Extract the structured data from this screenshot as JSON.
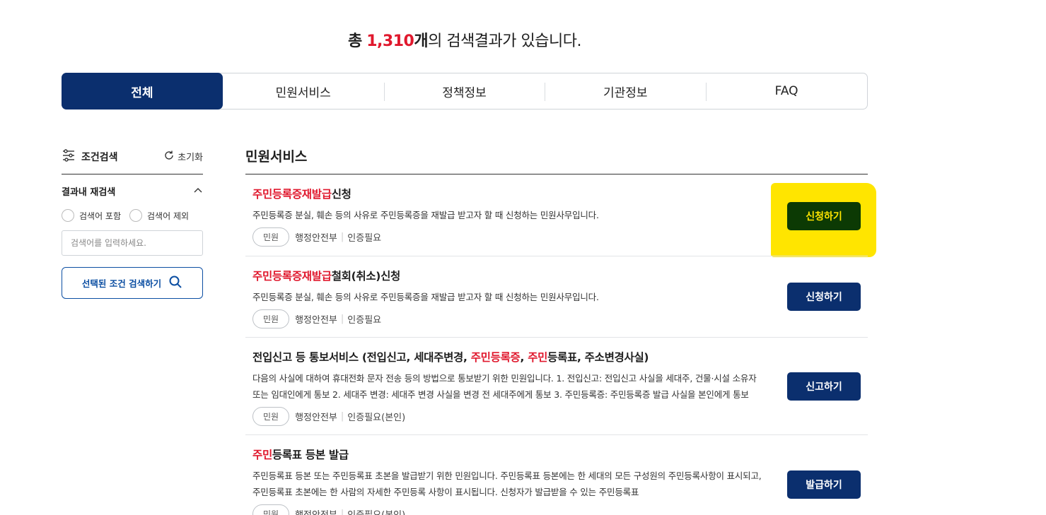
{
  "summary": {
    "prefix": "총",
    "count": "1,310",
    "unit": "개",
    "suffix": "의 검색결과가 있습니다."
  },
  "tabs": [
    {
      "label": "전체",
      "active": true
    },
    {
      "label": "민원서비스",
      "active": false
    },
    {
      "label": "정책정보",
      "active": false
    },
    {
      "label": "기관정보",
      "active": false
    },
    {
      "label": "FAQ",
      "active": false
    }
  ],
  "sidebar": {
    "title": "조건검색",
    "reset_label": "초기화",
    "re_search_label": "결과내 재검색",
    "radio_include": "검색어 포함",
    "radio_exclude": "검색어 제외",
    "input_placeholder": "검색어를 입력하세요.",
    "search_button": "선택된 조건 검색하기"
  },
  "main": {
    "section_title": "민원서비스",
    "items": [
      {
        "title_hl": "주민등록증재발급",
        "title_rest": "신청",
        "desc": "주민등록증 분실, 훼손 등의 사유로 주민등록증을 재발급 받고자 할 때 신청하는 민원사무입니다.",
        "chip": "민원",
        "org": "행정안전부",
        "auth": "인증필요",
        "action": "신청하기"
      },
      {
        "title_hl": "주민등록증재발급",
        "title_rest": "철회(취소)신청",
        "desc": "주민등록증 분실, 훼손 등의 사유로 주민등록증을 재발급 받고자 할 때 신청하는 민원사무입니다.",
        "chip": "민원",
        "org": "행정안전부",
        "auth": "인증필요",
        "action": "신청하기"
      },
      {
        "title_a": "전입신고 등 통보서비스 (전입신고, 세대주변경, ",
        "title_hl1": "주민등록증",
        "title_b": ", ",
        "title_hl2": "주민",
        "title_c": "등록표, 주소변경사실)",
        "desc": "다음의 사실에 대하여 휴대전화 문자 전송 등의 방법으로 통보받기 위한 민원입니다. 1. 전입신고: 전입신고 사실을 세대주, 건물·시설 소유자 또는 임대인에게 통보 2. 세대주 변경: 세대주 변경 사실을 변경 전 세대주에게 통보 3. 주민등록증: 주민등록증 발급 사실을 본인에게 통보",
        "chip": "민원",
        "org": "행정안전부",
        "auth": "인증필요(본인)",
        "action": "신고하기"
      },
      {
        "title_hl": "주민",
        "title_rest": "등록표 등본 발급",
        "desc": "주민등록표 등본 또는 주민등록표 초본을 발급받기 위한 민원입니다. 주민등록표 등본에는 한 세대의 모든 구성원의 주민등록사항이 표시되고, 주민등록표 초본에는 한 사람의 자세한 주민등록 사항이 표시됩니다. 신청자가 발급받을 수 있는 주민등록표",
        "chip": "민원",
        "org": "행정안전부",
        "auth": "인증필요(본인)",
        "action": "발급하기"
      }
    ]
  }
}
